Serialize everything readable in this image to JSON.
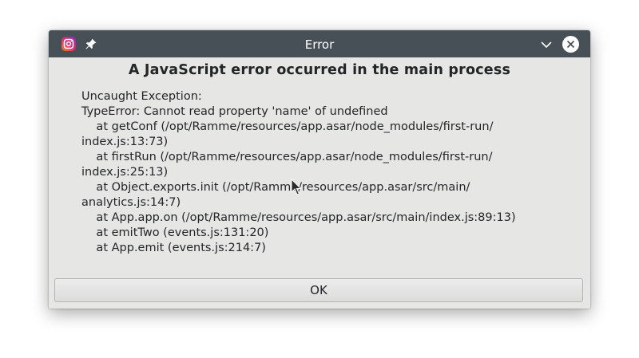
{
  "window": {
    "title": "Error"
  },
  "dialog": {
    "heading": "A JavaScript error occurred in the main process",
    "message_lines": [
      "Uncaught Exception:",
      "TypeError: Cannot read property 'name' of undefined",
      "    at getConf (/opt/Ramme/resources/app.asar/node_modules/first-run/",
      "index.js:13:73)",
      "    at firstRun (/opt/Ramme/resources/app.asar/node_modules/first-run/",
      "index.js:25:13)",
      "    at Object.exports.init (/opt/Ramme/resources/app.asar/src/main/",
      "analytics.js:14:7)",
      "    at App.app.on (/opt/Ramme/resources/app.asar/src/main/index.js:89:13)",
      "    at emitTwo (events.js:131:20)",
      "    at App.emit (events.js:214:7)"
    ],
    "ok_label": "OK"
  },
  "icons": {
    "app": "app-icon",
    "pin": "pin-icon",
    "minimize": "chevron-down-icon",
    "close": "close-icon",
    "cursor": "mouse-cursor-icon"
  },
  "colors": {
    "titlebar": "#475057",
    "dialog_background": "#e6e6e5",
    "text": "#232627",
    "app_icon_gradient": [
      "#f58529",
      "#dd2a7b",
      "#8134af"
    ]
  }
}
